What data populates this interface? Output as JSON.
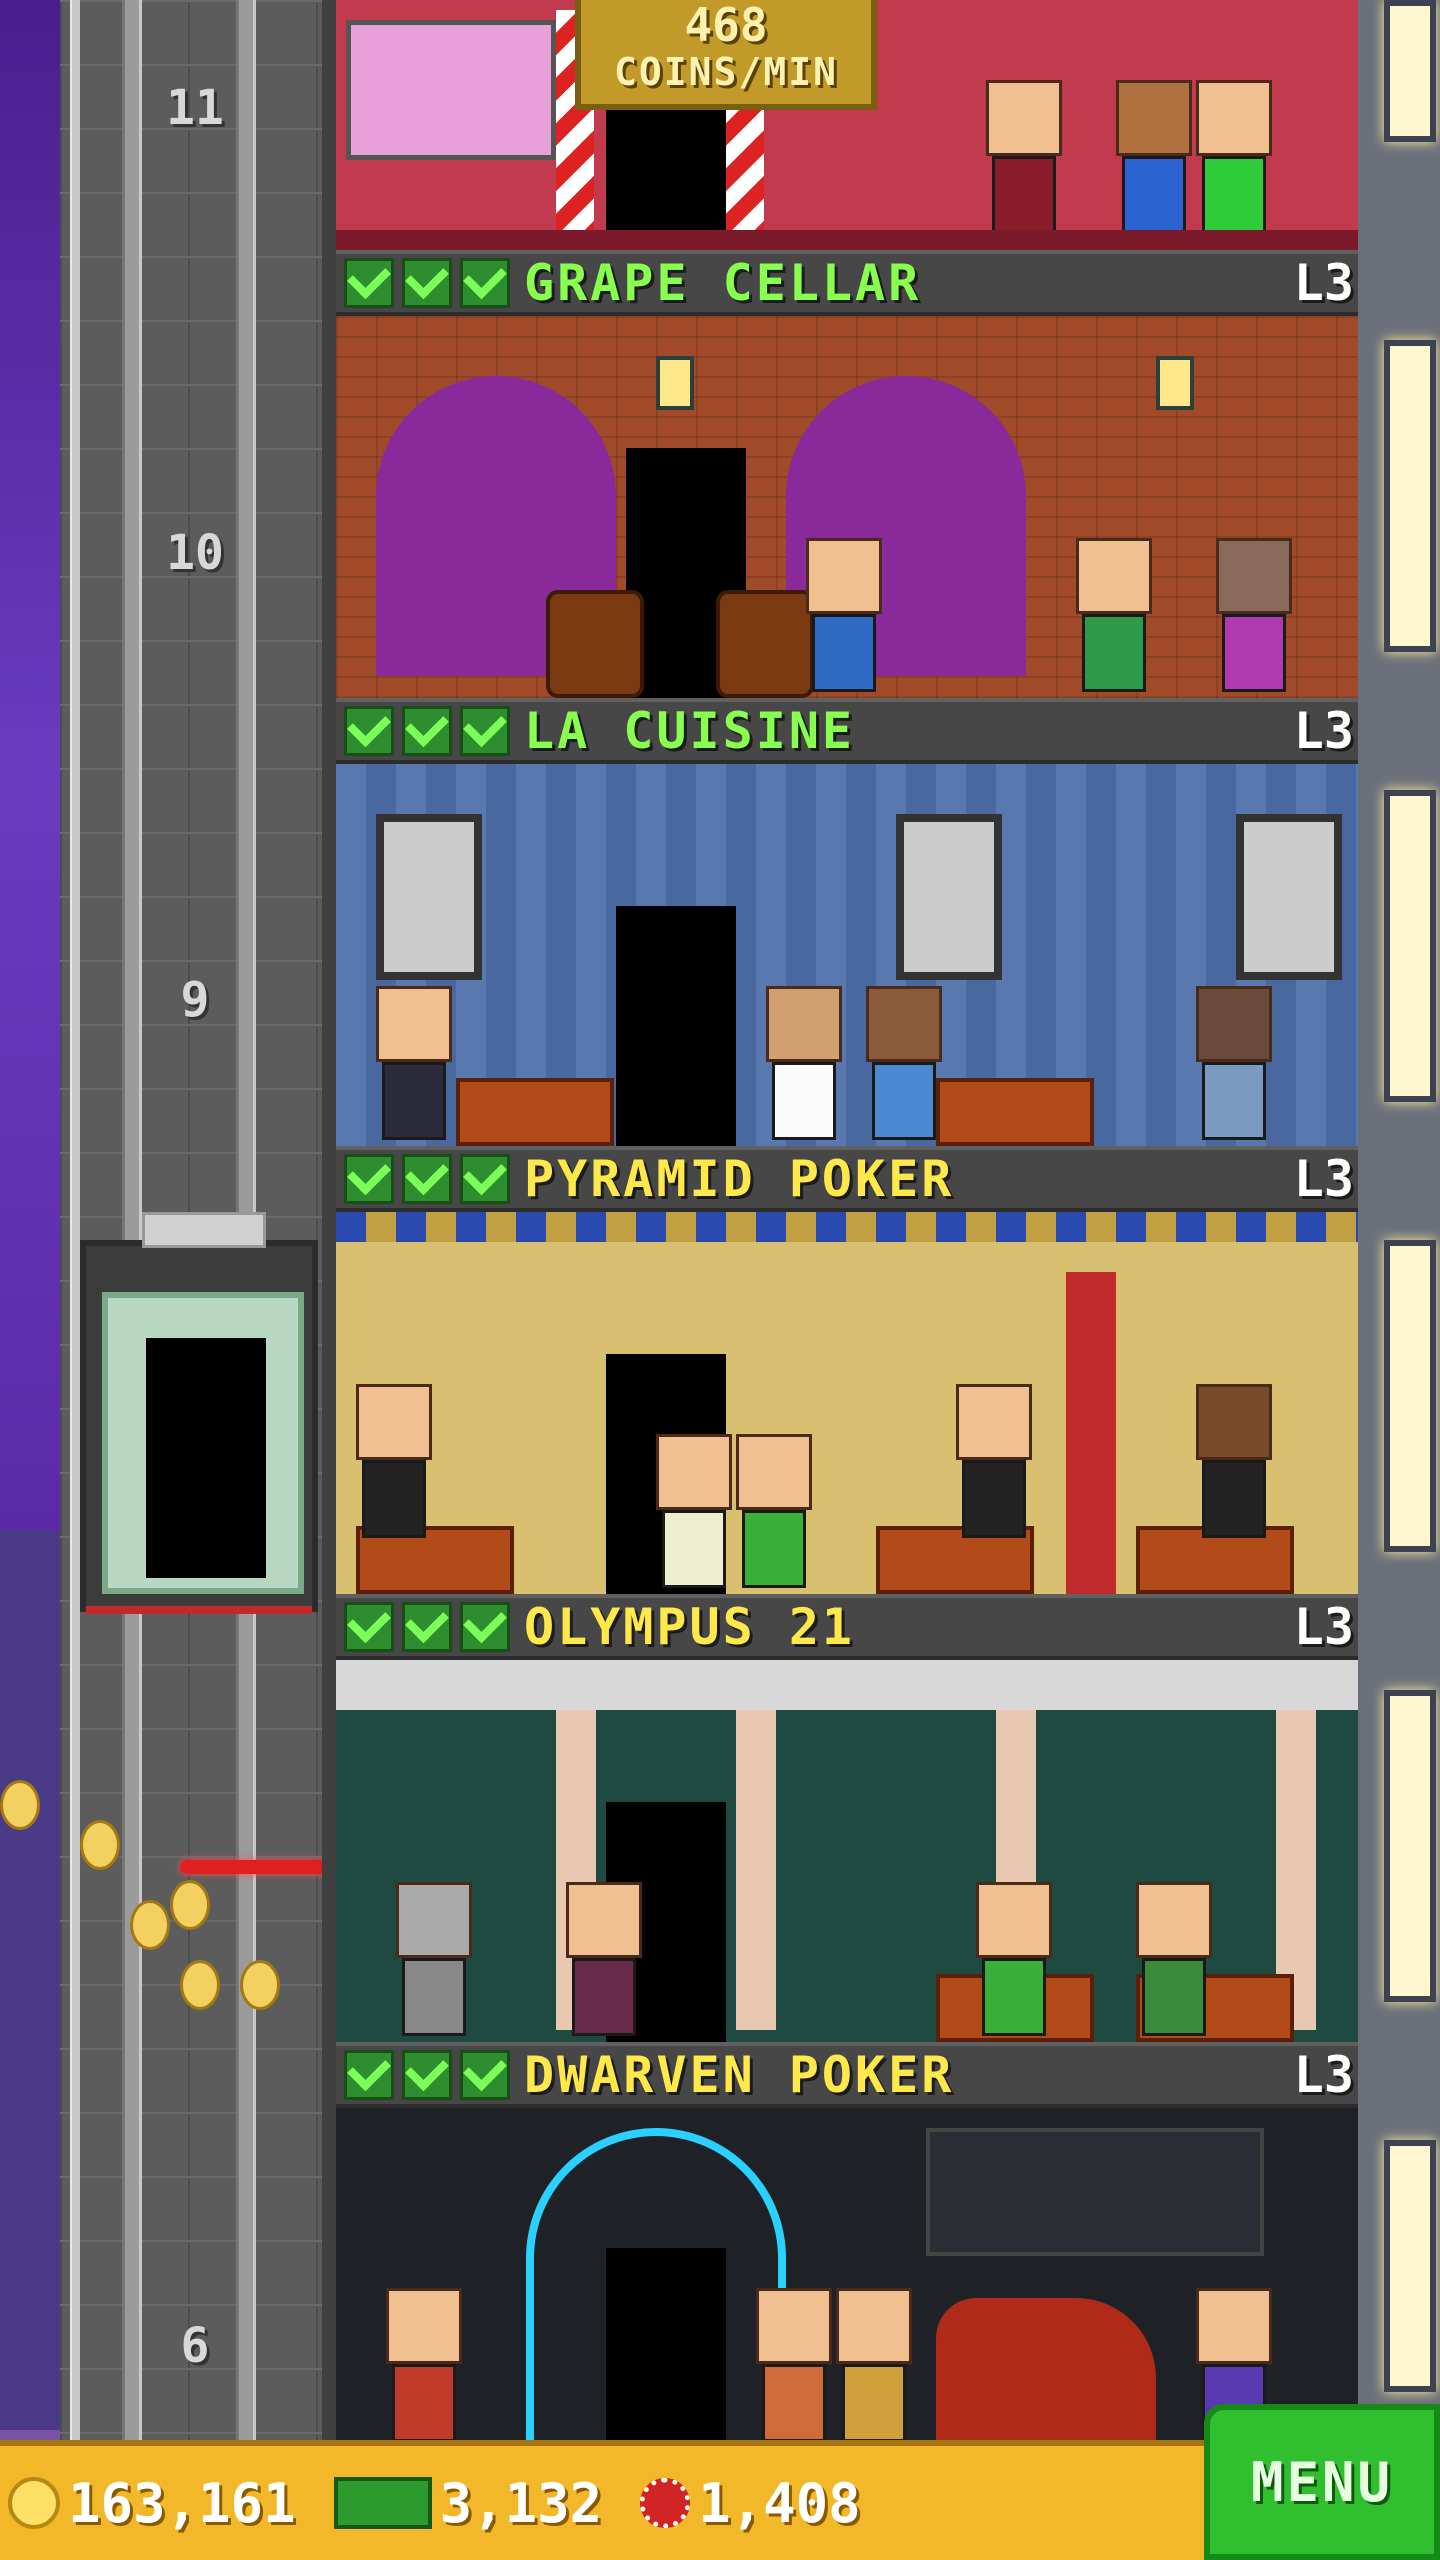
{
  "income_badge": {
    "value": "468",
    "unit": "COINS/MIN"
  },
  "shaft_floor_numbers": [
    "11",
    "10",
    "9",
    "6"
  ],
  "floors": [
    {
      "name": "GRAPE CELLAR",
      "level": "L3",
      "stocked_checks": 3,
      "name_color": "green"
    },
    {
      "name": "LA CUISINE",
      "level": "L3",
      "stocked_checks": 3,
      "name_color": "green"
    },
    {
      "name": "PYRAMID POKER",
      "level": "L3",
      "stocked_checks": 3,
      "name_color": "yellow"
    },
    {
      "name": "OLYMPUS 21",
      "level": "L3",
      "stocked_checks": 3,
      "name_color": "yellow"
    },
    {
      "name": "DWARVEN POKER",
      "level": "L3",
      "stocked_checks": 3,
      "name_color": "yellow"
    }
  ],
  "hud": {
    "coins": "163,161",
    "bux": "3,132",
    "chips": "1,408",
    "menu_label": "MENU"
  },
  "icons": [
    "coin-icon",
    "bux-icon",
    "chip-icon",
    "check-icon"
  ],
  "colors": {
    "hud_bg": "#f2b82a",
    "menu_bg": "#2fbf2f",
    "name_green": "#88ff4e",
    "name_yellow": "#ffe94a"
  }
}
